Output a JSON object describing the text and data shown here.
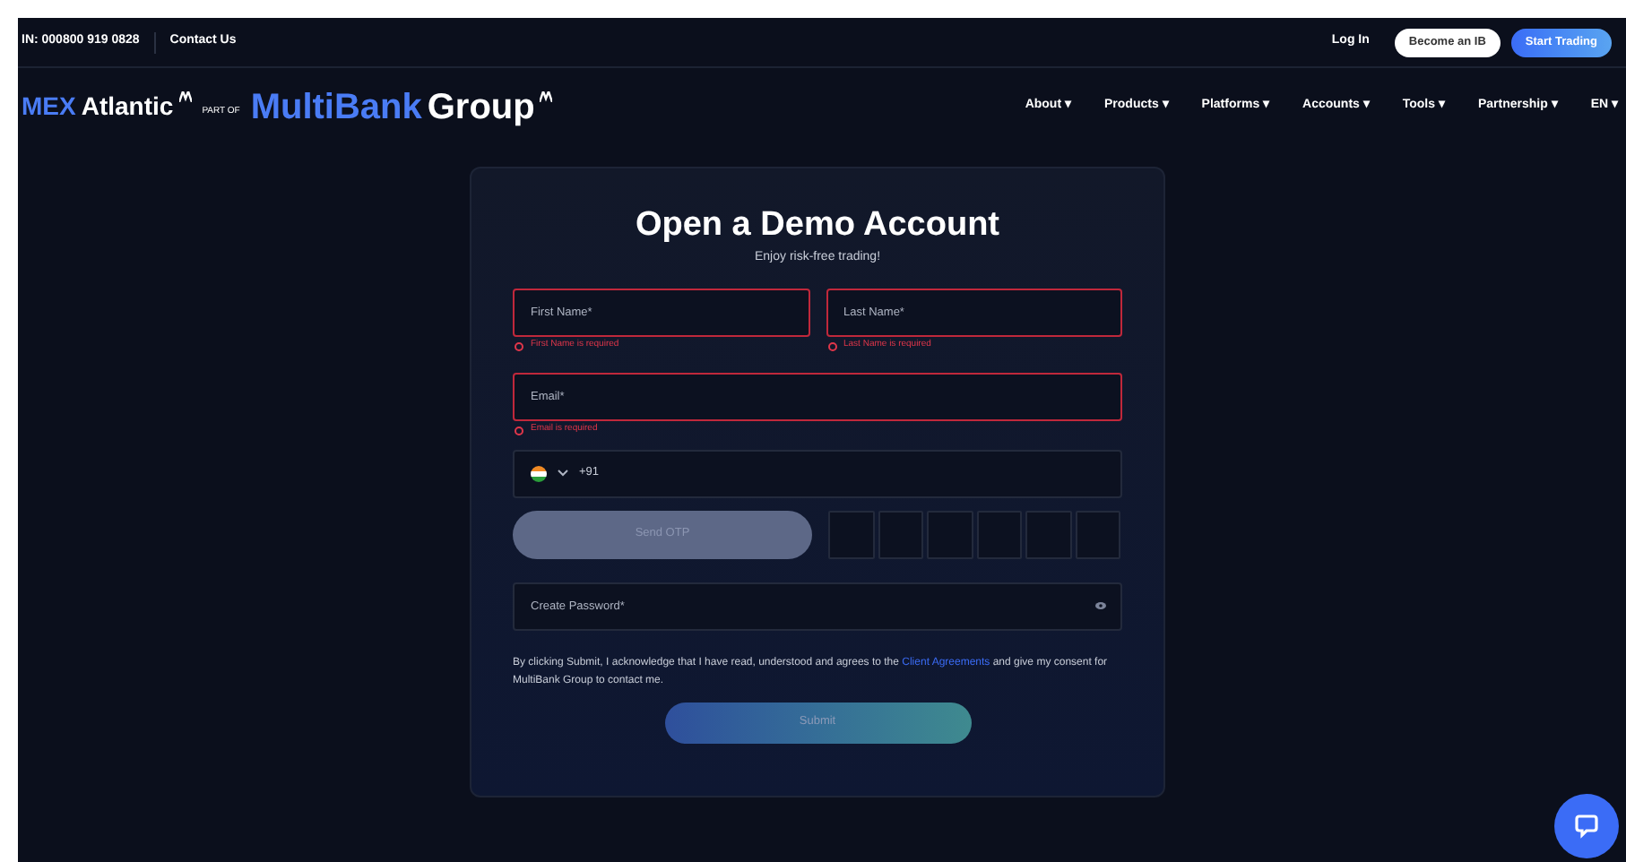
{
  "top_bar": {
    "phone": "IN: 000800 919 0828",
    "contact": "Contact Us",
    "login": "Log In",
    "buttons": [
      {
        "label": "Become an IB",
        "kind": "outline"
      },
      {
        "label": "Start Trading",
        "kind": "primary"
      }
    ]
  },
  "logo": {
    "brand": "MEX",
    "brand_rest": "Atlantic",
    "part_of": "PART OF",
    "group_a": "MultiBank",
    "group_b": "Group"
  },
  "nav": [
    {
      "label": "About",
      "caret": "▾"
    },
    {
      "label": "Products",
      "caret": "▾"
    },
    {
      "label": "Platforms",
      "caret": "▾"
    },
    {
      "label": "Accounts",
      "caret": "▾"
    },
    {
      "label": "Tools",
      "caret": "▾"
    },
    {
      "label": "Partnership",
      "caret": "▾"
    },
    {
      "label": "EN",
      "caret": "▾"
    }
  ],
  "form": {
    "title": "Open a Demo Account",
    "subtitle": "Enjoy risk-free trading!",
    "name_fields": [
      {
        "placeholder": "First Name*",
        "invalid": true,
        "error": "First Name is required"
      },
      {
        "placeholder": "Last Name*",
        "invalid": true,
        "error": "Last Name is required"
      }
    ],
    "email": {
      "placeholder": "Email*",
      "invalid": true,
      "error": "Email is required"
    },
    "phone": {
      "code": "+91"
    },
    "send_otp": {
      "label": "Send OTP",
      "disabled": true
    },
    "password": {
      "placeholder": "Create Password*"
    },
    "consent": "By clicking Submit, I acknowledge that I have read, understood and agrees to the ",
    "consent_link": "Client Agreements",
    "consent_end": " and give my consent for MultiBank Group to contact me.",
    "submit": {
      "label": "Submit",
      "disabled": true
    }
  }
}
